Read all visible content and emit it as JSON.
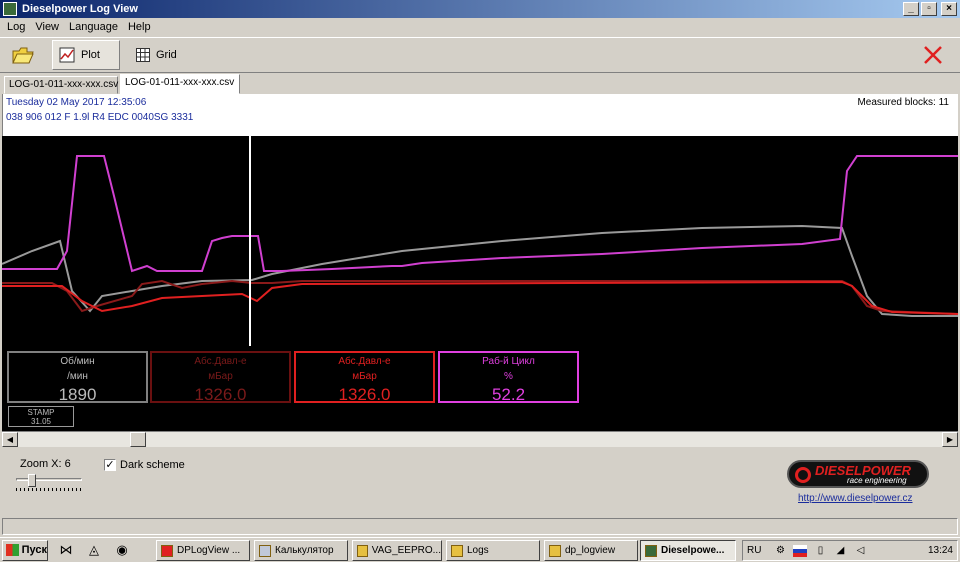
{
  "window": {
    "title": "Dieselpower Log View",
    "min": "_",
    "restore": "▫",
    "close": "×"
  },
  "menu": [
    "Log",
    "View",
    "Language",
    "Help"
  ],
  "toolbar": {
    "plot_label": "Plot",
    "grid_label": "Grid"
  },
  "tabs": [
    "LOG-01-011-xxx-xxx.csv",
    "LOG-01-011-xxx-xxx.csv"
  ],
  "info": {
    "date": "Tuesday 02 May 2017 12:35:06",
    "ecu": "038 906 012 F  1.9l R4 EDC 0040SG  3331",
    "measured_blocks": "Measured blocks: 11"
  },
  "channels": [
    {
      "label1": "Об/мин",
      "label2": "/мин",
      "value": "1890",
      "color": "#9a9a9a"
    },
    {
      "label1": "Абс.Давл-е",
      "label2": "мБар",
      "value": "1326.0",
      "color": "#7a1a1a"
    },
    {
      "label1": "Абс.Давл-е",
      "label2": "мБар",
      "value": "1326.0",
      "color": "#e02020"
    },
    {
      "label1": "Раб-й Цикл",
      "label2": "%",
      "value": "52.2",
      "color": "#e040e0"
    }
  ],
  "stamp": {
    "label": "STAMP",
    "value": "31.05"
  },
  "controls": {
    "zoom_label": "Zoom X: 6",
    "dark_scheme_label": "Dark scheme",
    "dark_scheme_checked": "✓"
  },
  "logo": {
    "brand": "DIESELPOWER",
    "tagline": "race engineering"
  },
  "link": "http://www.dieselpower.cz",
  "taskbar": {
    "start": "Пуск",
    "tasks": [
      "DPLogView ...",
      "Калькулятор",
      "VAG_EEPRO...",
      "Logs",
      "dp_logview",
      "Dieselpowe..."
    ],
    "lang": "RU",
    "clock": "13:24"
  }
}
